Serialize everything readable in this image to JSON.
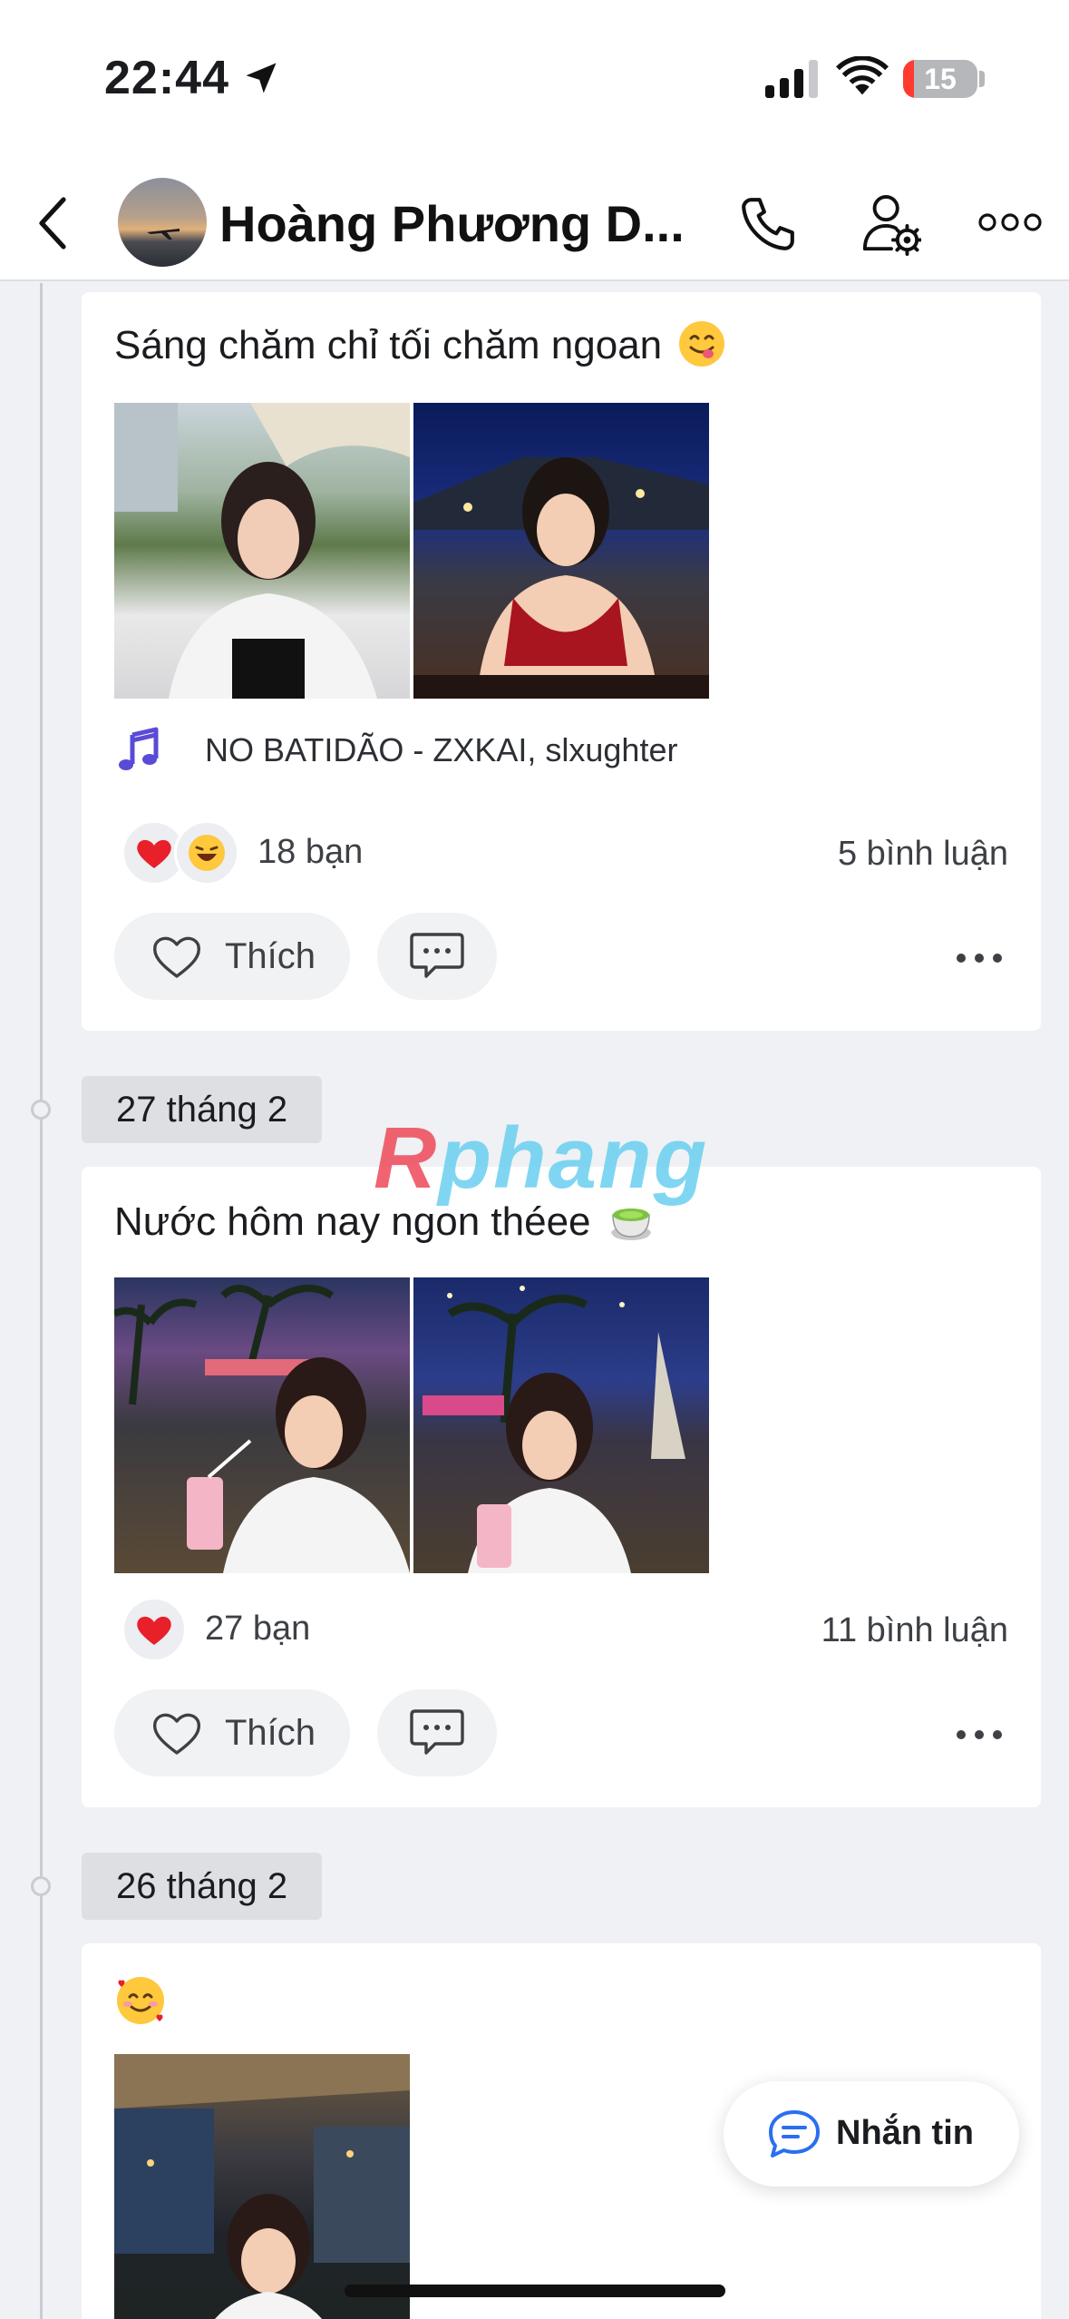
{
  "status_bar": {
    "time": "22:44",
    "battery": "15",
    "battery_level": 0.15
  },
  "header": {
    "title": "Hoàng Phương D..."
  },
  "posts": [
    {
      "text": "Sáng chăm chỉ tối chăm ngoan",
      "music": "NO BATIDÃO - ZXKAI, slxughter",
      "reactions": "18 bạn",
      "comments": "5 bình luận",
      "like_label": "Thích"
    },
    {
      "date": "27 tháng 2",
      "text": "Nước hôm nay ngon théee",
      "reactions": "27 bạn",
      "comments": "11 bình luận",
      "like_label": "Thích"
    },
    {
      "date": "26 tháng 2",
      "text": ""
    }
  ],
  "watermark": {
    "first": "R",
    "rest": "phang"
  },
  "fab": {
    "label": "Nhắn tin"
  },
  "colors": {
    "accent": "#2a6ff0",
    "heart": "#e8202a",
    "timeline": "#c9ccd1"
  }
}
